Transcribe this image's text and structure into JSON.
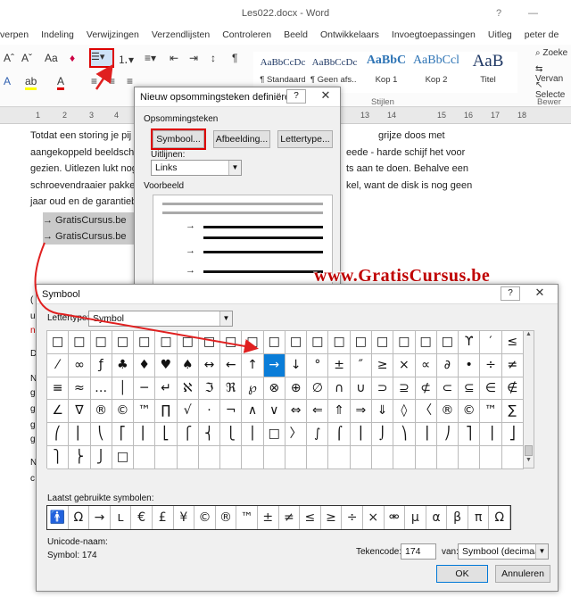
{
  "window": {
    "title": "Les022.docx - Word",
    "controls": [
      "?",
      "—"
    ]
  },
  "tabs": [
    "verpen",
    "Indeling",
    "Verwijzingen",
    "Verzendlijsten",
    "Controleren",
    "Beeld",
    "Ontwikkelaars",
    "Invoegtoepassingen",
    "Uitleg",
    "peter de"
  ],
  "ribbon": {
    "styles": [
      {
        "sample": "AaBbCcDc",
        "name": "¶ Standaard"
      },
      {
        "sample": "AaBbCcDc",
        "name": "¶ Geen afs..."
      },
      {
        "sample": "AaBbC",
        "name": "Kop 1"
      },
      {
        "sample": "AaBbCcl",
        "name": "Kop 2"
      },
      {
        "sample": "AaB",
        "name": "Titel"
      }
    ],
    "stijlen_label": "Stijlen",
    "right_items": [
      "Zoeke",
      "Vervan",
      "Selecte"
    ],
    "bewer_label": "Bewer"
  },
  "ruler": [
    "1",
    "2",
    "3",
    "4",
    "5",
    "6",
    "7",
    "8",
    "9",
    "10",
    "11",
    "12",
    "13",
    "14",
    "15",
    "16",
    "17",
    "18"
  ],
  "document": {
    "para1": [
      "Totdat een storing je pij",
      "grijze doos met",
      "aangekoppeld beeldsche",
      "eede - harde schijf het voor",
      "gezien. Uitlezen lukt nog",
      "ts aan te doen. Behalve een",
      "schroevendraaier pakke",
      "kel, want de disk is nog geen",
      "jaar oud en de garantieb"
    ],
    "bullets": [
      "→  GratisCursus.be",
      "→  GratisCursus.be"
    ],
    "side_letters": [
      "(",
      "u",
      "n",
      "D",
      "N",
      "g",
      "g",
      "g",
      "g",
      "N",
      "c"
    ]
  },
  "watermark": "www.GratisCursus.be",
  "bullet_dialog": {
    "title": "Nieuw opsommingsteken definiëren",
    "help": "?",
    "close": "✕",
    "section_label": "Opsommingsteken",
    "btn_symbol": "Symbool...",
    "btn_image": "Afbeelding...",
    "btn_font": "Lettertype...",
    "align_label": "Uitlijnen:",
    "align_value": "Links",
    "preview_label": "Voorbeeld",
    "preview_bullet": "→"
  },
  "symbol_dialog": {
    "title": "Symbool",
    "help": "?",
    "close": "✕",
    "font_label": "Lettertype:",
    "font_value": "Symbol",
    "grid": [
      [
        "□",
        "□",
        "□",
        "□",
        "□",
        "□",
        "□",
        "□",
        "□",
        "□",
        "□",
        "□",
        "□",
        "□",
        "□",
        "□",
        "□",
        "□",
        "□",
        "ϒ",
        "′",
        "≤"
      ],
      [
        "⁄",
        "∞",
        "ƒ",
        "♣",
        "♦",
        "♥",
        "♠",
        "↔",
        "←",
        "↑",
        "→",
        "↓",
        "°",
        "±",
        "″",
        "≥",
        "×",
        "∝",
        "∂",
        "•",
        "÷",
        "≠"
      ],
      [
        "≡",
        "≈",
        "…",
        "│",
        "─",
        "↵",
        "ℵ",
        "ℑ",
        "ℜ",
        "℘",
        "⊗",
        "⊕",
        "∅",
        "∩",
        "∪",
        "⊃",
        "⊇",
        "⊄",
        "⊂",
        "⊆",
        "∈",
        "∉"
      ],
      [
        "∠",
        "∇",
        "®",
        "©",
        "™",
        "∏",
        "√",
        "⋅",
        "¬",
        "∧",
        "∨",
        "⇔",
        "⇐",
        "⇑",
        "⇒",
        "⇓",
        "◊",
        "〈",
        "®",
        "©",
        "™",
        "∑"
      ],
      [
        "⎛",
        "⎜",
        "⎝",
        "⎡",
        "⎢",
        "⎣",
        "⎧",
        "⎨",
        "⎩",
        "⎪",
        "□",
        "〉",
        "∫",
        "⌠",
        "⎮",
        "⌡",
        "⎞",
        "⎟",
        "⎠",
        "⎤",
        "⎥",
        "⎦"
      ],
      [
        "⎫",
        "⎬",
        "⎭",
        "□",
        "",
        "",
        "",
        "",
        "",
        "",
        "",
        "",
        "",
        "",
        "",
        "",
        "",
        "",
        "",
        "",
        "",
        ""
      ]
    ],
    "selected_symbol": "→",
    "recent_label": "Laatst gebruikte symbolen:",
    "recent": [
      "🚹",
      "Ω",
      "→",
      "ʟ",
      "€",
      "£",
      "¥",
      "©",
      "®",
      "™",
      "±",
      "≠",
      "≤",
      "≥",
      "÷",
      "×",
      "⚮",
      "µ",
      "α",
      "β",
      "π",
      "Ω"
    ],
    "unicode_label": "Unicode-naam:",
    "unicode_value": "Symbol: 174",
    "code_label": "Tekencode:",
    "code_value": "174",
    "from_label": "van:",
    "from_value": "Symbool (decimaal)",
    "ok": "OK",
    "cancel": "Annuleren"
  },
  "colors": {
    "selected": "#0a7dd8",
    "highlight_red": "#d00000",
    "arrow_red": "#e02020"
  }
}
